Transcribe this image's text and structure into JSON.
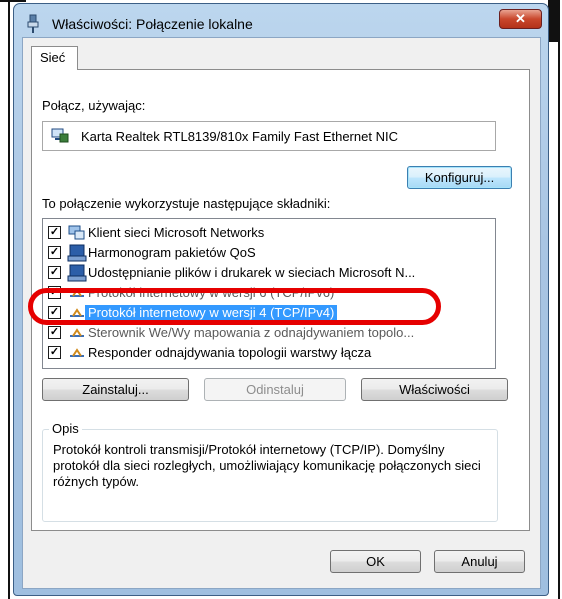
{
  "window": {
    "title": "Właściwości: Połączenie lokalne",
    "close_glyph": "✕"
  },
  "tabs": [
    {
      "label": "Sieć"
    }
  ],
  "connect_using": {
    "label": "Połącz, używając:",
    "adapter_name": "Karta Realtek RTL8139/810x Family Fast Ethernet NIC",
    "adapter_icon": "network-adapter-icon"
  },
  "buttons": {
    "configure": "Konfiguruj...",
    "install": "Zainstaluj...",
    "uninstall": "Odinstaluj",
    "properties": "Właściwości",
    "ok": "OK",
    "cancel": "Anuluj"
  },
  "components_label": "To połączenie wykorzystuje następujące składniki:",
  "components": [
    {
      "label": "Klient sieci Microsoft Networks",
      "checked": true,
      "icon": "network-client-icon"
    },
    {
      "label": "Harmonogram pakietów QoS",
      "checked": true,
      "icon": "service-icon"
    },
    {
      "label": "Udostępnianie plików i drukarek w sieciach Microsoft N...",
      "checked": true,
      "icon": "service-icon"
    },
    {
      "label": "Protokół internetowy w wersji 6 (TCP/IPv6)",
      "checked": true,
      "icon": "protocol-icon"
    },
    {
      "label": "Protokół internetowy w wersji 4 (TCP/IPv4)",
      "checked": true,
      "icon": "protocol-icon",
      "selected": true
    },
    {
      "label": "Sterownik We/Wy mapowania z odnajdywaniem topolo...",
      "checked": true,
      "icon": "protocol-icon"
    },
    {
      "label": "Responder odnajdywania topologii warstwy łącza",
      "checked": true,
      "icon": "protocol-icon"
    }
  ],
  "description": {
    "title": "Opis",
    "text": "Protokół kontroli transmisji/Protokół internetowy (TCP/IP). Domyślny protokół dla sieci rozległych, umożliwiający komunikację połączonych sieci różnych typów."
  },
  "colors": {
    "selection": "#3399ff",
    "highlight_oval": "#e60000",
    "close_button": "#c9472c"
  }
}
